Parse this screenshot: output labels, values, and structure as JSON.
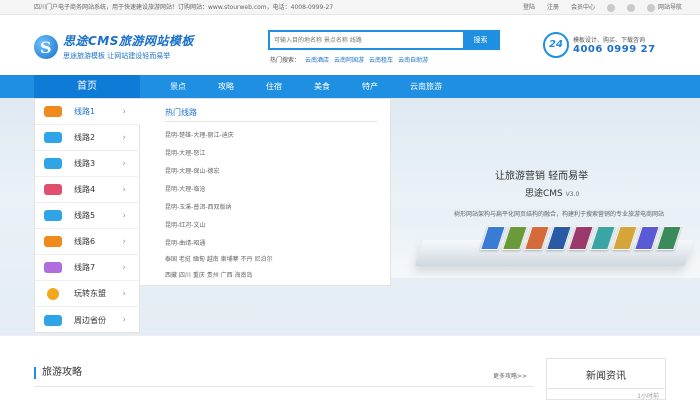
{
  "topbar": {
    "notice": "四川门户电子商务网站系统，用于快速建设旅游网站！订购网站：www.stourweb.com，电话：4008-0999-27",
    "login": "登陆",
    "register": "注册",
    "member": "会员中心",
    "nav": "网站导航"
  },
  "logo": {
    "title": "思途CMS旅游网站模板",
    "subtitle": "思途旅游模板 让网站建设轻而易举"
  },
  "search": {
    "placeholder": "可输入目的地名称 景点名称 线路",
    "button": "搜索",
    "hot_label": "热门搜索：",
    "hot_items": [
      "云南酒店",
      "云南阿国游",
      "云南租车",
      "云南自助游"
    ]
  },
  "phone": {
    "badge": "24",
    "line1": "模板设计、购买、下载咨询",
    "number": "4006 0999 27"
  },
  "nav": {
    "home": "首页",
    "items": [
      "景点",
      "攻略",
      "住宿",
      "美食",
      "特产",
      "云南旅游"
    ]
  },
  "menu": [
    {
      "label": "线路1",
      "icon": "bus-icon",
      "color": "#f08a1c"
    },
    {
      "label": "线路2",
      "icon": "car-icon",
      "color": "#2fa4e7"
    },
    {
      "label": "线路3",
      "icon": "bus-icon",
      "color": "#2fa4e7"
    },
    {
      "label": "线路4",
      "icon": "ship-icon",
      "color": "#e0506e"
    },
    {
      "label": "线路5",
      "icon": "ship-icon",
      "color": "#2fa4e7"
    },
    {
      "label": "线路6",
      "icon": "motorbike-icon",
      "color": "#f08a1c"
    },
    {
      "label": "线路7",
      "icon": "plane-icon",
      "color": "#b06de0"
    },
    {
      "label": "玩转东盟",
      "icon": "balloon-icon",
      "color": "#f0a81c"
    },
    {
      "label": "周边省份",
      "icon": "car-icon",
      "color": "#2fa4e7"
    }
  ],
  "submenu": {
    "title": "热门线路",
    "rows": [
      "昆明-楚雄-大理-丽江-迪庆",
      "昆明-大理-怒江",
      "昆明-大理-保山-德宏",
      "昆明-大理-临沧",
      "昆明-玉溪-普洱-西双版纳",
      "昆明-红河-文山",
      "昆明-曲靖-昭通",
      "泰国 老挝 缅甸 越南 柬埔寨 不丹 尼泊尔",
      "西藏 四川 重庆 贵州 广西 海南岛"
    ]
  },
  "banner": {
    "slogan": "让旅游营销 轻而易举",
    "brand": "思途CMS",
    "version": "V3.0",
    "desc": "树形网站架构与扁平化网页结构的融合，构建利于搜索营销的专业旅游电商网站"
  },
  "section": {
    "title": "旅游攻略",
    "more": "更多攻略>>"
  },
  "news": {
    "title": "新闻资讯",
    "time": "1小时前"
  }
}
